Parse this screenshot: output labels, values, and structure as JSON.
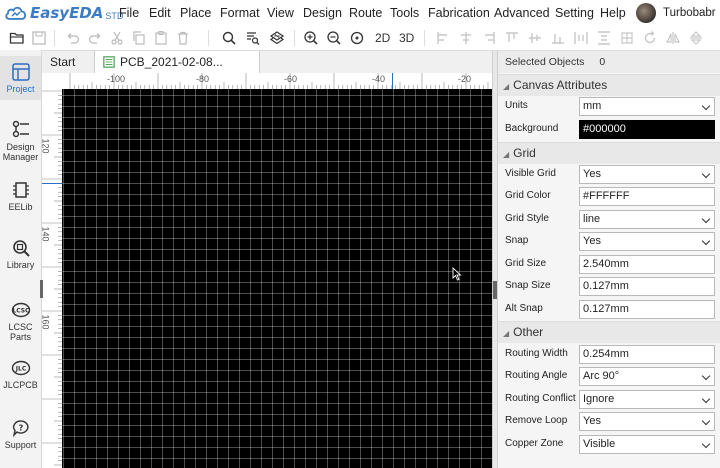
{
  "app": {
    "logo_text": "EasyEDA",
    "logo_sub": "STD"
  },
  "menu": [
    "File",
    "Edit",
    "Place",
    "Format",
    "View",
    "Design",
    "Route",
    "Tools",
    "Fabrication",
    "Advanced",
    "Setting",
    "Help"
  ],
  "user": {
    "name": "Turbobabr"
  },
  "toolbar": {
    "view_2d": "2D",
    "view_3d": "3D"
  },
  "sidebar": {
    "items": [
      {
        "label": "Project"
      },
      {
        "label": "Design Manager"
      },
      {
        "label": "EELib"
      },
      {
        "label": "Library"
      },
      {
        "label": "LCSC Parts"
      },
      {
        "label": "JLCPCB"
      },
      {
        "label": "Support"
      }
    ]
  },
  "tabs": [
    {
      "label": "Start"
    },
    {
      "label": "PCB_2021-02-08..."
    }
  ],
  "ruler": {
    "h": [
      "-100",
      "-80",
      "-60",
      "-40",
      "-20"
    ],
    "v": [
      "120",
      "140",
      "160"
    ]
  },
  "panel": {
    "selected_label": "Selected Objects",
    "selected_count": "0",
    "canvas_section": "Canvas Attributes",
    "grid_section": "Grid",
    "other_section": "Other",
    "props": {
      "units": {
        "label": "Units",
        "value": "mm"
      },
      "background": {
        "label": "Background",
        "value": "#000000"
      },
      "visible_grid": {
        "label": "Visible Grid",
        "value": "Yes"
      },
      "grid_color": {
        "label": "Grid Color",
        "value": "#FFFFFF"
      },
      "grid_style": {
        "label": "Grid Style",
        "value": "line"
      },
      "snap": {
        "label": "Snap",
        "value": "Yes"
      },
      "grid_size": {
        "label": "Grid Size",
        "value": "2.540mm"
      },
      "snap_size": {
        "label": "Snap Size",
        "value": "0.127mm"
      },
      "alt_snap": {
        "label": "Alt Snap",
        "value": "0.127mm"
      },
      "routing_width": {
        "label": "Routing Width",
        "value": "0.254mm"
      },
      "routing_angle": {
        "label": "Routing Angle",
        "value": "Arc 90°"
      },
      "routing_conflict": {
        "label": "Routing Conflict",
        "value": "Ignore"
      },
      "remove_loop": {
        "label": "Remove Loop",
        "value": "Yes"
      },
      "copper_zone": {
        "label": "Copper Zone",
        "value": "Visible"
      }
    }
  },
  "colors": {
    "accent": "#3d7cc4",
    "canvas": "#000000",
    "grid": "#FFFFFF"
  }
}
